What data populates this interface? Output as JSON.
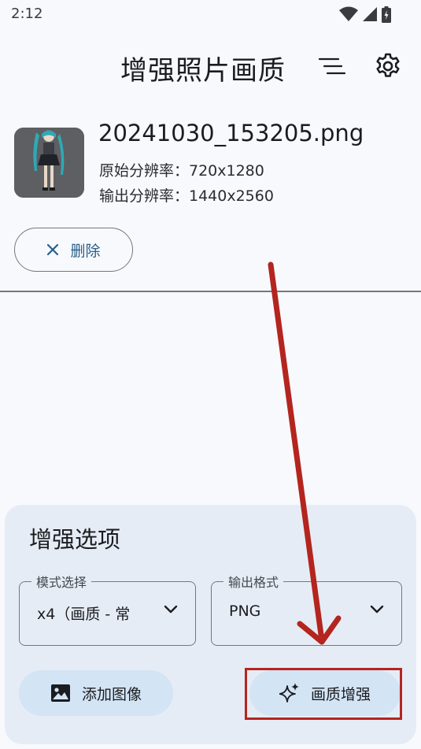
{
  "status_bar": {
    "time": "2:12"
  },
  "header": {
    "title": "增强照片画质"
  },
  "file": {
    "name": "20241030_153205.png",
    "original_resolution": "原始分辨率：720x1280",
    "output_resolution": "输出分辨率：1440x2560"
  },
  "actions": {
    "delete_label": "删除"
  },
  "options": {
    "title": "增强选项",
    "mode": {
      "label": "模式选择",
      "value": "x4（画质 - 常"
    },
    "format": {
      "label": "输出格式",
      "value": "PNG"
    },
    "add_image_label": "添加图像",
    "enhance_label": "画质增强"
  },
  "colors": {
    "accent": "#265f8a",
    "annotation": "#b3251e",
    "panel": "#e6ecf5",
    "button": "#d3e4f5"
  }
}
